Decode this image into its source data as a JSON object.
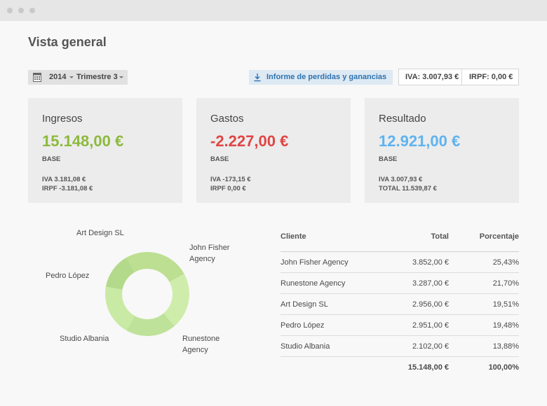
{
  "window": {
    "title_bar_dots": 3
  },
  "page": {
    "title": "Vista general"
  },
  "filters": {
    "year": "2014",
    "quarter": "Trimestre 3"
  },
  "toolbar": {
    "report_label": "Informe de perdidas y ganancias",
    "iva_total": "IVA: 3.007,93 €",
    "irpf_total": "IRPF: 0,00 €"
  },
  "colors": {
    "income": "#8cba3c",
    "expenses": "#e04545",
    "result": "#5fb3ef",
    "report_accent": "#2f73b0"
  },
  "cards": [
    {
      "title": "Ingresos",
      "amount": "15.148,00 €",
      "base": "BASE",
      "line1": "IVA 3.181,08 €",
      "line2": "IRPF -3.181,08 €"
    },
    {
      "title": "Gastos",
      "amount": "-2.227,00 €",
      "base": "BASE",
      "line1": "IVA -173,15 €",
      "line2": "IRPF 0,00 €"
    },
    {
      "title": "Resultado",
      "amount": "12.921,00 €",
      "base": "BASE",
      "line1": "IVA 3.007,93 €",
      "line2": "TOTAL 11.539,87 €"
    }
  ],
  "chart_data": {
    "type": "pie",
    "categories": [
      "John Fisher Agency",
      "Runestone Agency",
      "Art Design SL",
      "Pedro López",
      "Studio Albania"
    ],
    "values": [
      25.43,
      21.7,
      19.51,
      19.48,
      13.88
    ],
    "labels": [
      "John Fisher\nAgency",
      "Runestone\nAgency",
      "Art Design SL",
      "Pedro López",
      "Studio Albania"
    ]
  },
  "table": {
    "headers": [
      "Cliente",
      "Total",
      "Porcentaje"
    ],
    "rows": [
      [
        "John Fisher Agency",
        "3.852,00 €",
        "25,43%"
      ],
      [
        "Runestone Agency",
        "3.287,00 €",
        "21,70%"
      ],
      [
        "Art Design SL",
        "2.956,00 €",
        "19,51%"
      ],
      [
        "Pedro López",
        "2.951,00 €",
        "19,48%"
      ],
      [
        "Studio Albania",
        "2.102,00 €",
        "13,88%"
      ]
    ],
    "total": [
      "",
      "15.148,00 €",
      "100,00%"
    ]
  }
}
